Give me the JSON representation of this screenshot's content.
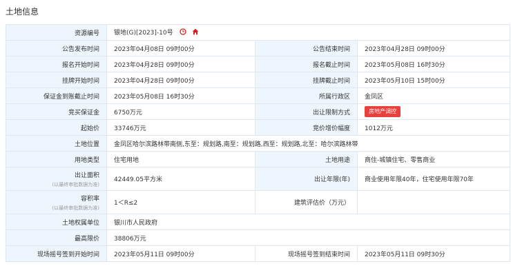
{
  "section": {
    "title": "土地信息"
  },
  "colors": {
    "label_bg": "#eef5fc",
    "border": "#dfe7f0",
    "badge_bg": "#e8403c",
    "icon_red": "#d0211c"
  },
  "rows": {
    "resource_no": {
      "label": "资源编号",
      "value": "银地(G)[2023]-10号",
      "icons": [
        "clock-icon",
        "home-icon"
      ]
    },
    "announce": {
      "start_label": "公告发布时间",
      "start_value": "2023年04月08日 09时00分",
      "end_label": "公告结束时间",
      "end_value": "2023年04月28日 09时00分"
    },
    "signup": {
      "start_label": "报名开始时间",
      "start_value": "2023年04月28日 09时00分",
      "end_label": "报名截止时间",
      "end_value": "2023年05月08日 16时30分"
    },
    "listing": {
      "start_label": "挂牌开始时间",
      "start_value": "2023年04月28日 09时00分",
      "end_label": "挂牌截止时间",
      "end_value": "2023年05月10日 15时00分"
    },
    "deposit": {
      "label": "保证金到账截止时间",
      "value": "2023年05月08日 16时30分",
      "district_label": "所属行政区",
      "district_value": "金凤区"
    },
    "bid_deposit": {
      "label": "竞买保证金",
      "value": "6750万元",
      "restrict_label": "出让限制方式",
      "restrict_badge": "房地产调控"
    },
    "start_price": {
      "label": "起始价",
      "value": "33746万元",
      "increment_label": "竞价增价幅度",
      "increment_value": "1012万元"
    },
    "location": {
      "label": "土地位置",
      "value": "金凤区哈尔滨路林带南侧,东至：规划路,南至：规划路,西至：规划路,北至：哈尔滨路林带"
    },
    "usage": {
      "type_label": "用地类型",
      "type_value": "住宅用地",
      "use_label": "土地用途",
      "use_value": "商住-城镇住宅、零售商业"
    },
    "area": {
      "label": "出让面积",
      "sub": "(以最终审批数据为准)",
      "value": "42449.05平方米",
      "term_label": "出让年限(年)",
      "term_value": "商业使用年限40年，住宅使用年限70年"
    },
    "far": {
      "label": "容积率",
      "sub": "(以最终审批数据为准)",
      "value": "1＜R≤2",
      "eval_label": "建筑评估价（万元）",
      "eval_value": ""
    },
    "owner": {
      "label": "土地权属单位",
      "value": "银川市人民政府"
    },
    "max_price": {
      "label": "最高限价",
      "value": "38806万元"
    },
    "draw": {
      "start_label": "现场摇号签到开始时间",
      "start_value": "2023年05月11日 09时00分",
      "end_label": "现场摇号签到结束时间",
      "end_value": "2023年05月11日 09时30分"
    }
  }
}
